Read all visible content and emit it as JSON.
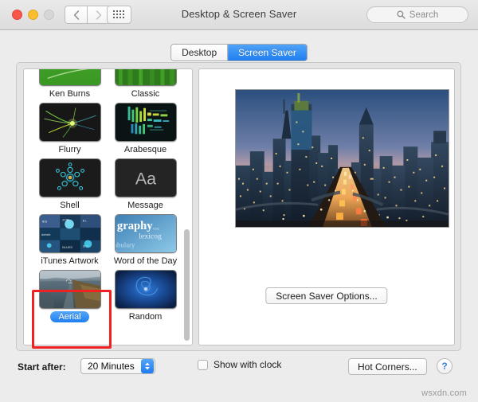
{
  "window": {
    "title": "Desktop & Screen Saver",
    "traffic_lights": [
      "close",
      "minimize",
      "maximize"
    ],
    "nav_back_icon": "chevron-left-icon",
    "nav_forward_icon": "chevron-right-icon",
    "grid_icon": "show-all-grid-icon"
  },
  "search": {
    "placeholder": "Search",
    "icon": "search-icon",
    "value": ""
  },
  "tabs": [
    {
      "label": "Desktop",
      "active": false
    },
    {
      "label": "Screen Saver",
      "active": true
    }
  ],
  "savers": [
    {
      "label": "Ken Burns",
      "thumb": "kenburns",
      "selected": false
    },
    {
      "label": "Classic",
      "thumb": "classic",
      "selected": false
    },
    {
      "label": "Flurry",
      "thumb": "flurry",
      "selected": false
    },
    {
      "label": "Arabesque",
      "thumb": "arabesque",
      "selected": false
    },
    {
      "label": "Shell",
      "thumb": "shell",
      "selected": false
    },
    {
      "label": "Message",
      "thumb": "message",
      "selected": false
    },
    {
      "label": "iTunes Artwork",
      "thumb": "itunes",
      "selected": false
    },
    {
      "label": "Word of the Day",
      "thumb": "wotd",
      "selected": false
    },
    {
      "label": "Aerial",
      "thumb": "aerial",
      "selected": true
    },
    {
      "label": "Random",
      "thumb": "random",
      "selected": false
    }
  ],
  "preview": {
    "description": "Aerial cityscape at dusk with illuminated highway and skyscrapers",
    "options_button": "Screen Saver Options..."
  },
  "bottom": {
    "start_after_label": "Start after:",
    "start_after_value": "20 Minutes",
    "stepper_icon": "stepper-up-down-icon",
    "show_clock_label": "Show with clock",
    "show_clock_checked": false,
    "hot_corners_label": "Hot Corners...",
    "help_label": "?"
  },
  "annotation": {
    "highlight_target": "Aerial",
    "color": "#ee2222"
  },
  "watermark": "wsxdn.com",
  "colors": {
    "accent_blue": "#1f7ff0",
    "titlebar": "#e4e4e4",
    "panel": "#e4e4e4",
    "annotation_red": "#ee2222"
  }
}
